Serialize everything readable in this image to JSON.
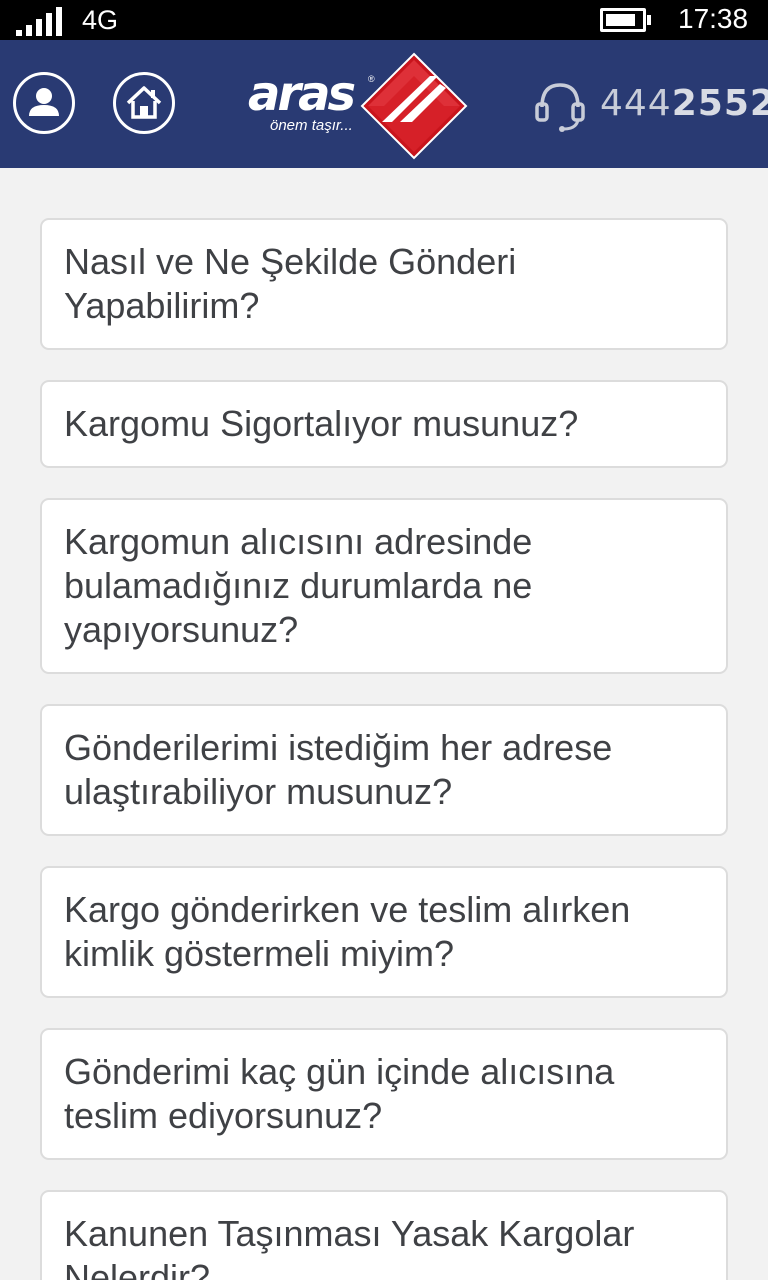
{
  "status_bar": {
    "network": "4G",
    "time": "17:38",
    "signal_bars": 5,
    "battery_level": 0.85,
    "icons": [
      "signal-icon",
      "battery-icon"
    ]
  },
  "header": {
    "background_color": "#293a73",
    "logo_text": "aras",
    "logo_registered": "®",
    "logo_tagline": "önem taşır...",
    "phone_prefix": "444",
    "phone_main": "2552",
    "icons": [
      "user-icon",
      "home-icon",
      "aras-logo-mark",
      "headset-icon"
    ],
    "brand_red": "#c8141c"
  },
  "faq": {
    "items": [
      {
        "question": "Nasıl ve Ne Şekilde Gönderi Yapabilirim?"
      },
      {
        "question": "Kargomu Sigortalıyor musunuz?"
      },
      {
        "question": "Kargomun alıcısını adresinde bulamadığınız durumlarda ne yapıyorsunuz?"
      },
      {
        "question": "Gönderilerimi istediğim her adrese ulaştırabiliyor musunuz?"
      },
      {
        "question": "Kargo gönderirken ve teslim alırken kimlik göstermeli miyim?"
      },
      {
        "question": "Gönderimi kaç gün içinde alıcısına teslim ediyorsunuz?"
      },
      {
        "question": "Kanunen Taşınması Yasak Kargolar Nelerdir?"
      }
    ]
  }
}
